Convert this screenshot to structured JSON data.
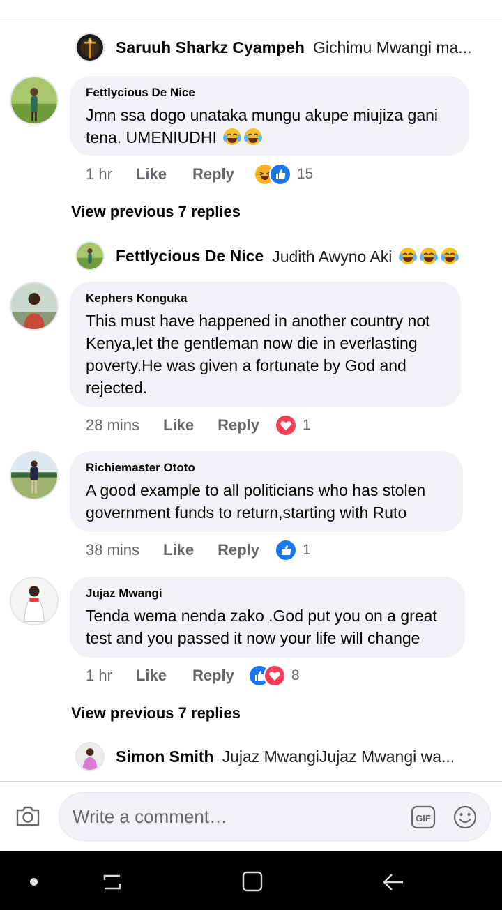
{
  "thread": [
    {
      "type": "reply_preview",
      "name": "Saruuh Sharkz Cyampeh",
      "text": "Gichimu Mwangi ma..."
    },
    {
      "type": "comment",
      "author": "Fettlycious De Nice",
      "text": "Jmn ssa dogo unataka mungu akupe miujiza gani tena.  UMENIUDHI",
      "time": "1 hr",
      "like": "Like",
      "reply": "Reply",
      "reactions": [
        "haha",
        "like"
      ],
      "count": "15"
    },
    {
      "type": "view_previous",
      "label": "View previous 7 replies"
    },
    {
      "type": "reply_preview",
      "name": "Fettlycious De Nice",
      "text": "Judith Awyno Aki"
    },
    {
      "type": "comment",
      "author": "Kephers Konguka",
      "text": "This must have happened in another country not Kenya,let the gentleman now die in everlasting poverty.He was given a fortunate by God and rejected.",
      "time": "28 mins",
      "like": "Like",
      "reply": "Reply",
      "reactions": [
        "love"
      ],
      "count": "1"
    },
    {
      "type": "comment",
      "author": "Richiemaster Ototo",
      "text": "A good example to all politicians who has stolen government funds to return,starting with Ruto",
      "time": "38 mins",
      "like": "Like",
      "reply": "Reply",
      "reactions": [
        "like"
      ],
      "count": "1"
    },
    {
      "type": "comment",
      "author": "Jujaz Mwangi",
      "text": "Tenda wema nenda zako .God put you on a great test and you passed it now  your life will  change",
      "time": "1 hr",
      "like": "Like",
      "reply": "Reply",
      "reactions": [
        "like",
        "love"
      ],
      "count": "8"
    },
    {
      "type": "view_previous",
      "label": "View previous 7 replies"
    },
    {
      "type": "reply_preview",
      "name": "Simon Smith",
      "text": "Jujaz MwangiJujaz Mwangi wa..."
    }
  ],
  "composer": {
    "placeholder": "Write a comment…",
    "gif_label": "GIF"
  },
  "colors": {
    "like": "#1877f2",
    "love": "#f33e58",
    "haha": "#f7b125",
    "bubble": "#f0f2f5",
    "meta": "#65676b"
  }
}
